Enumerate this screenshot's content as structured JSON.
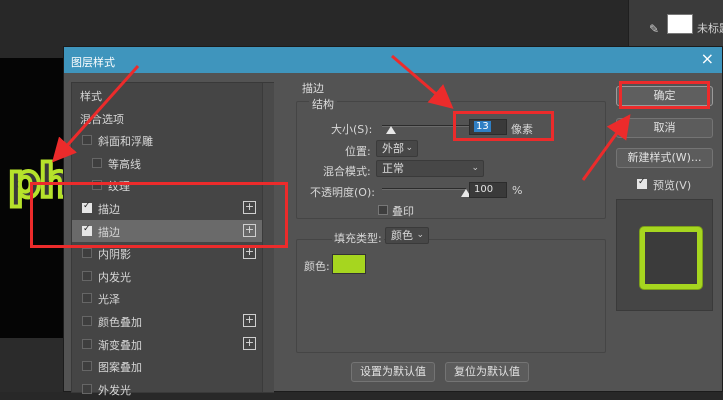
{
  "background": {
    "canvas_text": "ph",
    "layers_panel": {
      "layer_name": "未标题",
      "brush_icon": "brush-icon"
    }
  },
  "dialog": {
    "title": "图层样式",
    "close_icon": "×",
    "style_list": [
      {
        "label": "样式",
        "checkbox": false,
        "checked": false,
        "plus": false,
        "indent": 0
      },
      {
        "label": "混合选项",
        "checkbox": false,
        "checked": false,
        "plus": false,
        "indent": 0
      },
      {
        "label": "斜面和浮雕",
        "checkbox": true,
        "checked": false,
        "plus": false,
        "indent": 0
      },
      {
        "label": "等高线",
        "checkbox": true,
        "checked": false,
        "plus": false,
        "indent": 1
      },
      {
        "label": "纹理",
        "checkbox": true,
        "checked": false,
        "plus": false,
        "indent": 1
      },
      {
        "label": "描边",
        "checkbox": true,
        "checked": true,
        "plus": true,
        "indent": 0
      },
      {
        "label": "描边",
        "checkbox": true,
        "checked": true,
        "plus": true,
        "indent": 0,
        "selected": true
      },
      {
        "label": "内阴影",
        "checkbox": true,
        "checked": false,
        "plus": true,
        "indent": 0
      },
      {
        "label": "内发光",
        "checkbox": true,
        "checked": false,
        "plus": false,
        "indent": 0
      },
      {
        "label": "光泽",
        "checkbox": true,
        "checked": false,
        "plus": false,
        "indent": 0
      },
      {
        "label": "颜色叠加",
        "checkbox": true,
        "checked": false,
        "plus": true,
        "indent": 0
      },
      {
        "label": "渐变叠加",
        "checkbox": true,
        "checked": false,
        "plus": true,
        "indent": 0
      },
      {
        "label": "图案叠加",
        "checkbox": true,
        "checked": false,
        "plus": false,
        "indent": 0
      },
      {
        "label": "外发光",
        "checkbox": true,
        "checked": false,
        "plus": false,
        "indent": 0
      }
    ],
    "stroke": {
      "section_title": "描边",
      "structure_title": "结构",
      "size_label": "大小(S):",
      "size_value": "13",
      "size_unit": "像素",
      "position_label": "位置:",
      "position_value": "外部",
      "blend_label": "混合模式:",
      "blend_value": "正常",
      "opacity_label": "不透明度(O):",
      "opacity_value": "100",
      "opacity_unit": "%",
      "opacity_fraction": 1.0,
      "size_fraction": 0.1,
      "overprint_label": "叠印",
      "fill_type_label": "填充类型:",
      "fill_type_value": "颜色",
      "color_label": "颜色:",
      "color_value": "#a6d61f"
    },
    "buttons": {
      "set_default": "设置为默认值",
      "reset_default": "复位为默认值",
      "ok": "确定",
      "cancel": "取消",
      "new_style": "新建样式(W)...",
      "preview_label": "预览(V)"
    }
  },
  "colors": {
    "accent_title": "#3f95bd",
    "annotation_red": "#ec2b2b",
    "stroke_green": "#a6d61f"
  }
}
